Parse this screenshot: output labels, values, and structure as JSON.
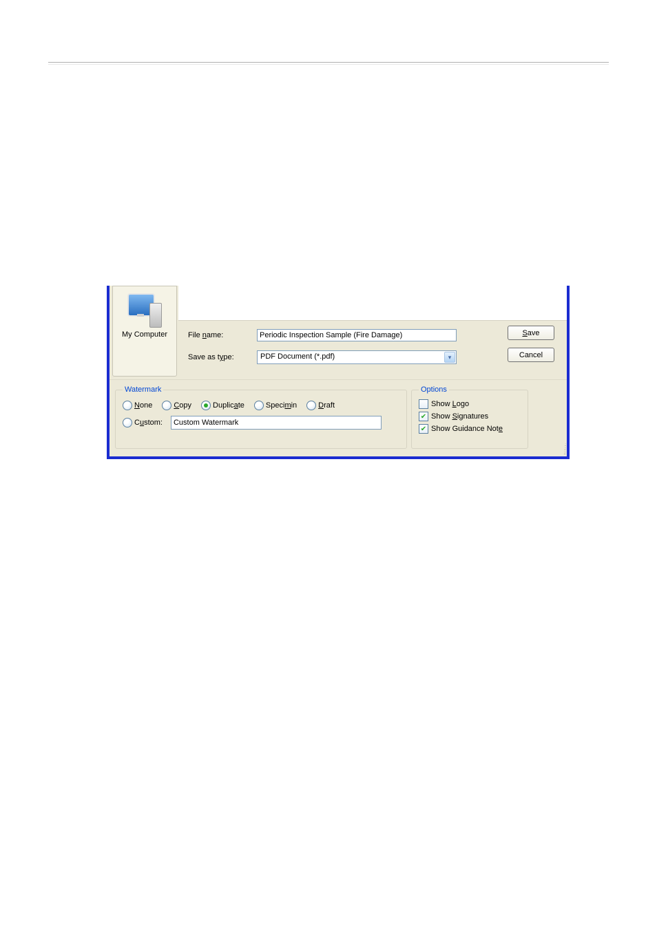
{
  "sidebar": {
    "my_computer_label": "My Computer"
  },
  "form": {
    "file_name_label": "File name:",
    "file_name_value": "Periodic Inspection Sample (Fire Damage)",
    "save_as_type_label": "Save as type:",
    "save_as_type_value": "PDF Document (*.pdf)"
  },
  "buttons": {
    "save_letter": "S",
    "save_rest": "ave",
    "cancel_label": "Cancel"
  },
  "watermark": {
    "legend": "Watermark",
    "none_pre": "",
    "none_ul": "N",
    "none_post": "one",
    "copy_pre": "",
    "copy_ul": "C",
    "copy_post": "opy",
    "dup_pre": "Duplic",
    "dup_ul": "a",
    "dup_post": "te",
    "spec_pre": "Speci",
    "spec_ul": "m",
    "spec_post": "in",
    "draft_pre": "",
    "draft_ul": "D",
    "draft_post": "raft",
    "custom_pre": "C",
    "custom_ul": "u",
    "custom_post": "stom:",
    "custom_value": "Custom Watermark"
  },
  "options": {
    "legend": "Options",
    "logo_pre": "Show ",
    "logo_ul": "L",
    "logo_post": "ogo",
    "sig_pre": "Show ",
    "sig_ul": "S",
    "sig_post": "ignatures",
    "guide_pre": "Show Guidance Not",
    "guide_ul": "e",
    "guide_post": ""
  }
}
